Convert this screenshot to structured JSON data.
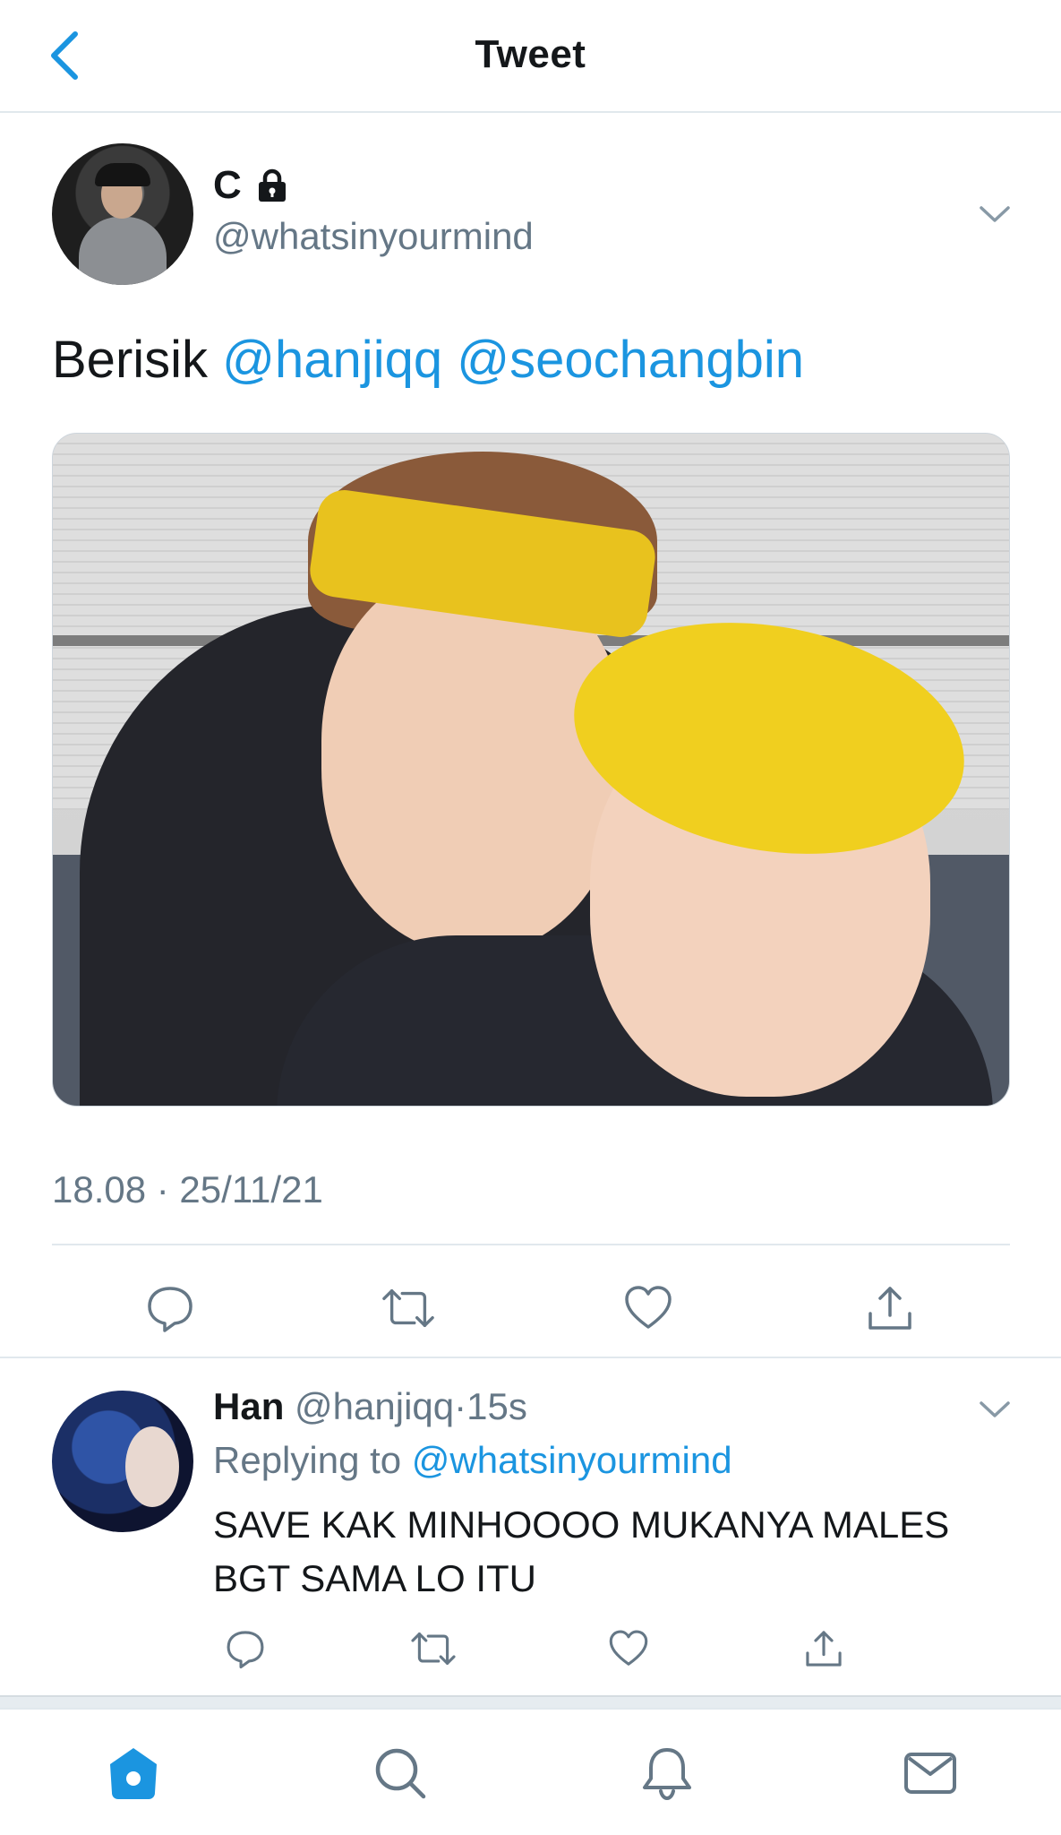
{
  "header": {
    "title": "Tweet",
    "back_icon": "chevron-left-icon"
  },
  "tweet": {
    "author_name": "C",
    "author_handle": "@whatsinyourmind",
    "protected_icon": "lock-icon",
    "text_prefix": "Berisik",
    "mentions": [
      "@hanjiqq",
      "@seochangbin"
    ],
    "timestamp": "18.08 · 25/11/21",
    "actions": [
      "reply-icon",
      "retweet-icon",
      "like-icon",
      "share-icon"
    ]
  },
  "reply": {
    "author_name": "Han",
    "author_handle": "@hanjiqq",
    "separator": "·",
    "time_ago": "15s",
    "replying_label": "Replying to",
    "replying_handle": "@whatsinyourmind",
    "text": "SAVE KAK MINHOOOO MUKANYA MALES BGT SAMA LO ITU"
  },
  "tabbar": {
    "items": [
      "home-icon",
      "search-icon",
      "notifications-icon",
      "messages-icon"
    ]
  },
  "colors": {
    "accent": "#1b95e0",
    "muted": "#657786",
    "text": "#14171a",
    "divider": "#e1e8ed"
  }
}
